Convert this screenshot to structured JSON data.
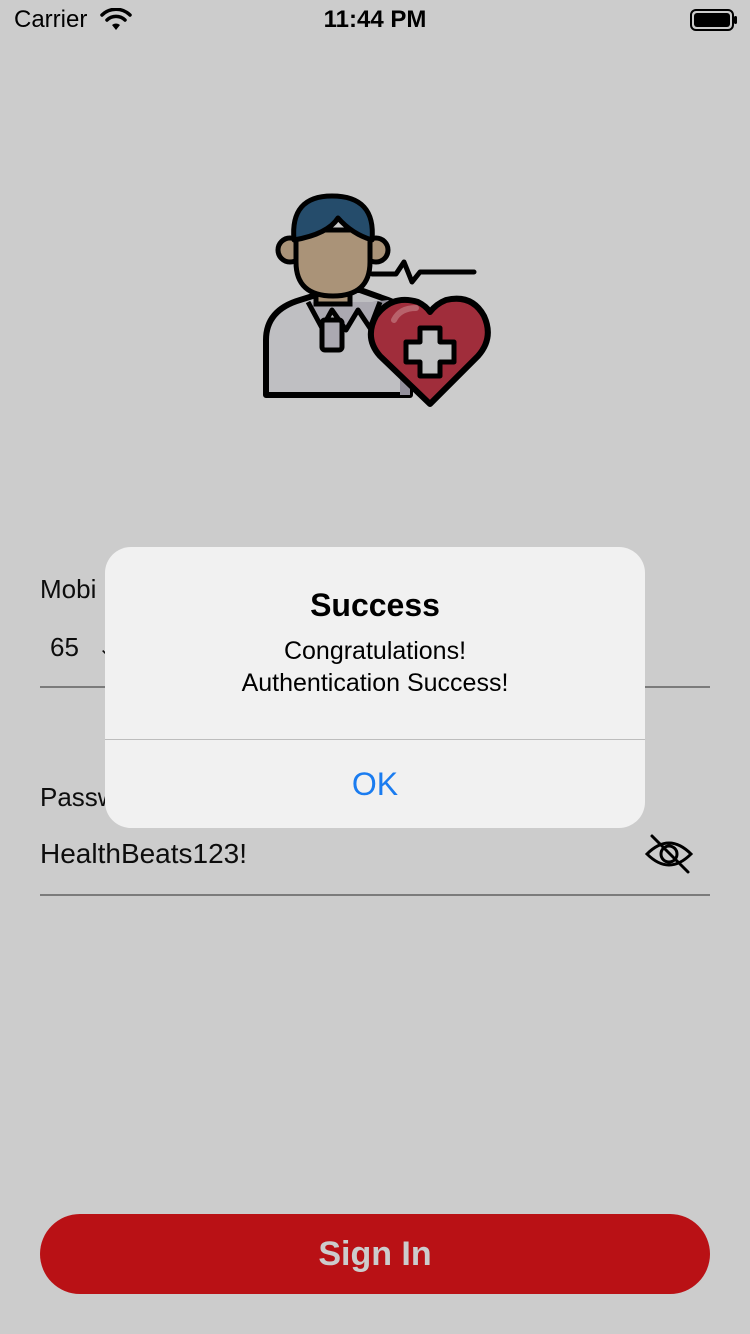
{
  "status_bar": {
    "carrier": "Carrier",
    "time": "11:44 PM"
  },
  "form": {
    "mobile_label": "Mobi",
    "country_code": "65",
    "password_label": "Passw",
    "password_value": "HealthBeats123!"
  },
  "sign_in_label": "Sign In",
  "alert": {
    "title": "Success",
    "message_line1": "Congratulations!",
    "message_line2": "Authentication Success!",
    "ok_label": "OK"
  },
  "colors": {
    "accent_red": "#e8161b",
    "link_blue": "#1a7cf0",
    "heart_red": "#c8394a",
    "hair_blue": "#2f5f86"
  },
  "icons": [
    "wifi-icon",
    "battery-icon",
    "doctor-heart-logo",
    "eye-slash-icon"
  ]
}
